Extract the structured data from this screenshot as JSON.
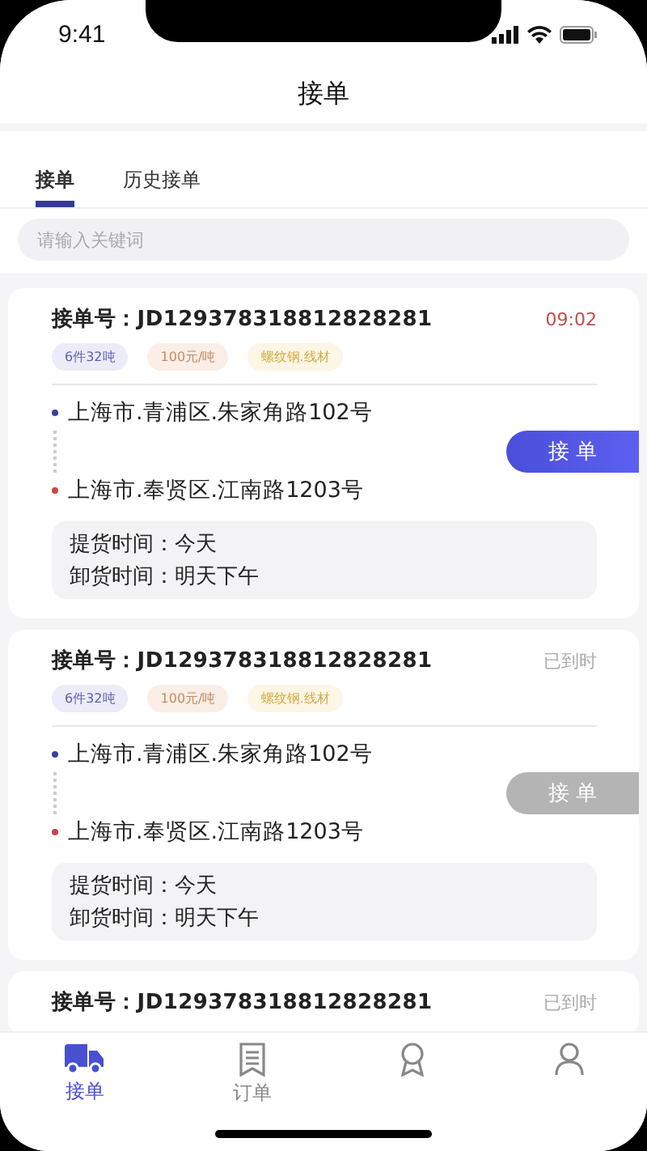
{
  "status_bar": {
    "time": "9:41"
  },
  "header": {
    "title": "接单"
  },
  "tabs": [
    {
      "label": "接单",
      "selected": true
    },
    {
      "label": "历史接单",
      "selected": false
    }
  ],
  "search": {
    "placeholder": "请输入关键词"
  },
  "orders": [
    {
      "number_label": "接单号：",
      "number": "JD129378318812828281",
      "status": "09:02",
      "overdue": false,
      "tags": [
        {
          "text": "6件32吨",
          "kind": "quantity"
        },
        {
          "text": "100元/吨",
          "kind": "price"
        },
        {
          "text": "螺纹钢.线材",
          "kind": "cargo"
        }
      ],
      "from": "上海市.青浦区.朱家角路102号",
      "to": "上海市.奉贤区.江南路1203号",
      "button": "接 单",
      "disabled": false,
      "times": [
        {
          "label": "提货时间：",
          "value": "今天"
        },
        {
          "label": "卸货时间：",
          "value": "明天下午"
        }
      ]
    },
    {
      "number_label": "接单号：",
      "number": "JD129378318812828281",
      "status": "已到时",
      "overdue": true,
      "tags": [
        {
          "text": "6件32吨",
          "kind": "quantity"
        },
        {
          "text": "100元/吨",
          "kind": "price"
        },
        {
          "text": "螺纹钢.线材",
          "kind": "cargo"
        }
      ],
      "from": "上海市.青浦区.朱家角路102号",
      "to": "上海市.奉贤区.江南路1203号",
      "button": "接 单",
      "disabled": true,
      "times": [
        {
          "label": "提货时间：",
          "value": "今天"
        },
        {
          "label": "卸货时间：",
          "value": "明天下午"
        }
      ]
    },
    {
      "number_label": "接单号：",
      "number": "JD129378318812828281",
      "status": "已到时",
      "overdue": true
    }
  ],
  "tab_bar": [
    {
      "label": "接单",
      "kind": "truck",
      "selected": true
    },
    {
      "label": "订单",
      "kind": "receipt",
      "selected": false
    },
    {
      "kind": "medal",
      "selected": false
    },
    {
      "kind": "person",
      "selected": false
    }
  ]
}
